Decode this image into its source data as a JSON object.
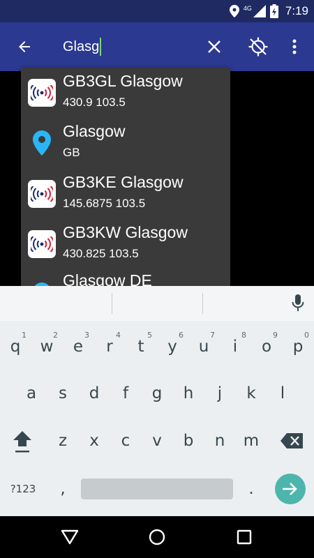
{
  "status_bar": {
    "network_label": "4G",
    "time": "7:19",
    "icons": [
      "location-icon",
      "signal-icon",
      "battery-charging-icon"
    ]
  },
  "app_bar": {
    "search_value": "Glasg",
    "icons": [
      "back-arrow-icon",
      "clear-icon",
      "gps-off-icon",
      "more-vert-icon"
    ],
    "colors": {
      "status_bar": "#1f2a63",
      "toolbar": "#2b3990",
      "caret": "#7cd37a"
    }
  },
  "suggestions": [
    {
      "title": "GB3GL Glasgow",
      "subtitle": "430.9  103.5",
      "icon": "repeater-icon"
    },
    {
      "title": "Glasgow",
      "subtitle": "GB",
      "icon": "place-icon"
    },
    {
      "title": "GB3KE Glasgow",
      "subtitle": "145.6875  103.5",
      "icon": "repeater-icon"
    },
    {
      "title": "GB3KW Glasgow",
      "subtitle": "430.825  103.5",
      "icon": "repeater-icon"
    },
    {
      "title": "Glasgow DE",
      "subtitle": "",
      "icon": "place-icon"
    }
  ],
  "keyboard": {
    "row1": [
      {
        "k": "q",
        "h": "1"
      },
      {
        "k": "w",
        "h": "2"
      },
      {
        "k": "e",
        "h": "3"
      },
      {
        "k": "r",
        "h": "4"
      },
      {
        "k": "t",
        "h": "5"
      },
      {
        "k": "y",
        "h": "6"
      },
      {
        "k": "u",
        "h": "7"
      },
      {
        "k": "i",
        "h": "8"
      },
      {
        "k": "o",
        "h": "9"
      },
      {
        "k": "p",
        "h": "0"
      }
    ],
    "row2": [
      "a",
      "s",
      "d",
      "f",
      "g",
      "h",
      "j",
      "k",
      "l"
    ],
    "row3": [
      "z",
      "x",
      "c",
      "v",
      "b",
      "n",
      "m"
    ],
    "symbols_label": "?123",
    "comma": ",",
    "period": ".",
    "icons": [
      "mic-icon",
      "shift-icon",
      "backspace-icon",
      "enter-arrow-icon"
    ],
    "accent_color": "#4db6ac"
  },
  "nav_bar": {
    "icons": [
      "back-triangle-icon",
      "home-circle-icon",
      "recents-square-icon"
    ]
  }
}
